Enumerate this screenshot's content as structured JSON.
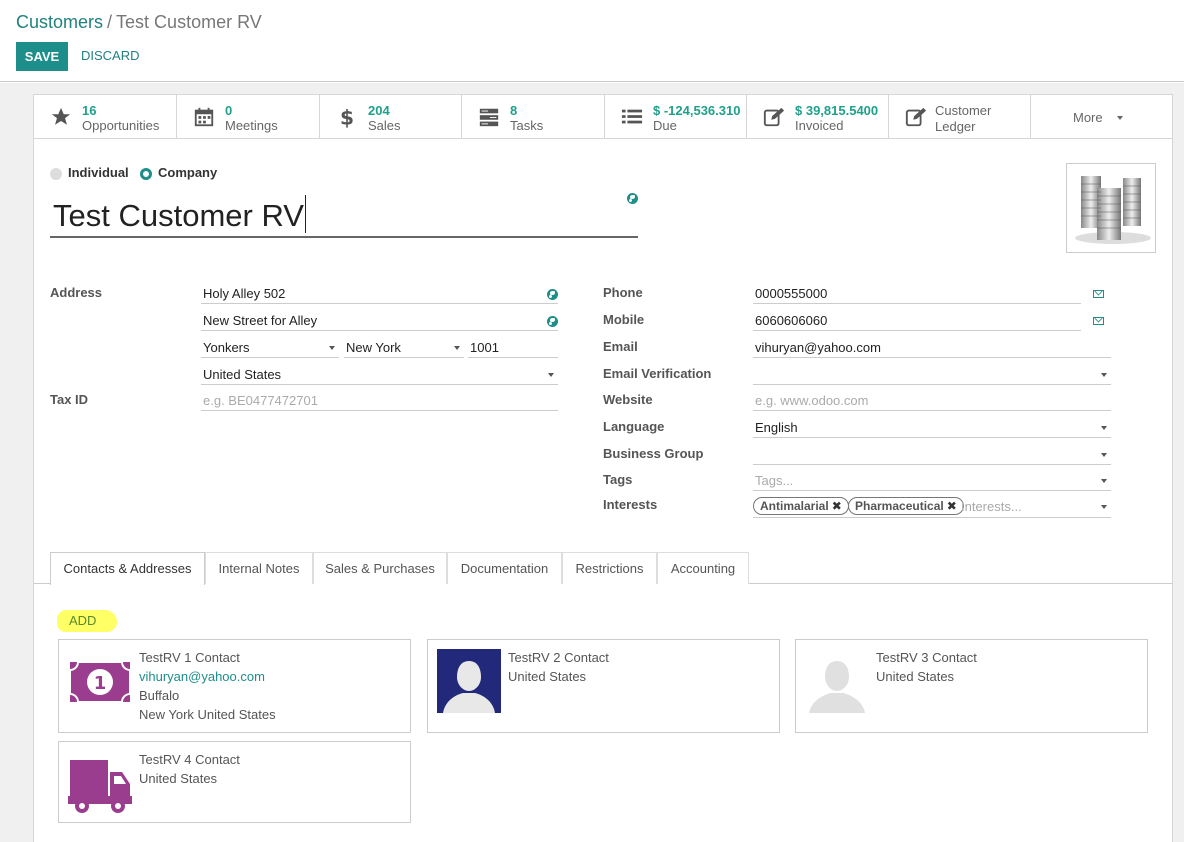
{
  "breadcrumb": {
    "parent": "Customers",
    "separator": "/",
    "current": "Test Customer RV"
  },
  "actions": {
    "save": "SAVE",
    "discard": "DISCARD"
  },
  "stats": [
    {
      "num": "16",
      "label": "Opportunities",
      "icon": "star-icon"
    },
    {
      "num": "0",
      "label": "Meetings",
      "icon": "calendar-icon"
    },
    {
      "num": "204",
      "label": "Sales",
      "icon": "dollar-icon"
    },
    {
      "num": "8",
      "label": "Tasks",
      "icon": "tasks-icon"
    },
    {
      "num": "$ -124,536.310",
      "label": "Due",
      "icon": "list-icon"
    },
    {
      "num": "$ 39,815.5400",
      "label": "Invoiced",
      "icon": "edit-icon"
    },
    {
      "label": "Customer Ledger",
      "icon": "edit-icon"
    }
  ],
  "more": "More",
  "company_type": {
    "individual": "Individual",
    "company": "Company"
  },
  "name": "Test Customer RV",
  "address": {
    "label": "Address",
    "street": "Holy Alley 502",
    "street2": "New Street for Alley",
    "city": "Yonkers",
    "state": "New York",
    "zip": "1001",
    "country": "United States"
  },
  "tax": {
    "label": "Tax ID",
    "placeholder": "e.g. BE0477472701"
  },
  "right": {
    "phone_label": "Phone",
    "phone": "0000555000",
    "mobile_label": "Mobile",
    "mobile": "6060606060",
    "email_label": "Email",
    "email": "vihuryan@yahoo.com",
    "email_verif_label": "Email Verification",
    "website_label": "Website",
    "website_placeholder": "e.g. www.odoo.com",
    "language_label": "Language",
    "language": "English",
    "business_group_label": "Business Group",
    "tags_label": "Tags",
    "tags_placeholder": "Tags...",
    "interests_label": "Interests",
    "interests_placeholder": "Interests...",
    "interests": [
      "Antimalarial",
      "Pharmaceutical"
    ]
  },
  "tabs": [
    "Contacts & Addresses",
    "Internal Notes",
    "Sales & Purchases",
    "Documentation",
    "Restrictions",
    "Accounting"
  ],
  "add": "ADD",
  "contacts": [
    {
      "name": "TestRV 1 Contact",
      "email": "vihuryan@yahoo.com",
      "line1": "Buffalo",
      "line2": "New York United States"
    },
    {
      "name": "TestRV 2 Contact",
      "line1": "United States"
    },
    {
      "name": "TestRV 3 Contact",
      "line1": "United States"
    },
    {
      "name": "TestRV 4 Contact",
      "line1": "United States"
    }
  ],
  "colors": {
    "accent": "#1e8e8a",
    "stat_number": "#1fa08a",
    "highlight": "#ffff66",
    "avatar_purple": "#9b3d8e",
    "avatar_navy": "#23297a"
  }
}
